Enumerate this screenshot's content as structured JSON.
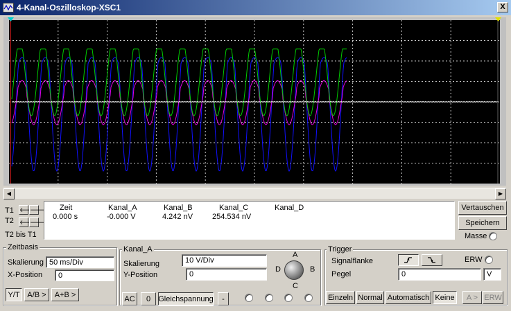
{
  "window": {
    "title": "4-Kanal-Oszilloskop-XSC1",
    "close_label": "X"
  },
  "cursors": {
    "t1_label": "T1",
    "t2_label": "T2",
    "t2_minus_t1_label": "T2 bis T1"
  },
  "readout": {
    "headers": [
      "Zeit",
      "Kanal_A",
      "Kanal_B",
      "Kanal_C",
      "Kanal_D"
    ],
    "row": [
      "0.000 s",
      "-0.000 V",
      "4.242 nV",
      "254.534 nV",
      ""
    ]
  },
  "side_buttons": {
    "reverse": "Vertauschen",
    "save": "Speichern",
    "ground": "Masse"
  },
  "timebase": {
    "title": "Zeitbasis",
    "scale_label": "Skalierung",
    "scale_value": "50 ms/Div",
    "xpos_label": "X-Position",
    "xpos_value": "0",
    "modes": [
      "Y/T",
      "A/B >",
      "A+B >"
    ],
    "active_mode": "Y/T"
  },
  "channel": {
    "title": "Kanal_A",
    "scale_label": "Skalierung",
    "scale_value": "10  V/Div",
    "ypos_label": "Y-Position",
    "ypos_value": "0",
    "coupling": [
      "AC",
      "0",
      "Gleichspannung",
      "-"
    ],
    "knob_labels": {
      "top": "A",
      "right": "B",
      "bottom": "C",
      "left": "D"
    }
  },
  "trigger": {
    "title": "Trigger",
    "edge_label": "Signalflanke",
    "ext_label": "ERW",
    "level_label": "Pegel",
    "level_value": "0",
    "level_unit": "V",
    "modes": [
      "Einzeln",
      "Normal",
      "Automatisch",
      "Keine"
    ],
    "active_mode": "Keine",
    "extra": [
      "A >",
      "ERW"
    ]
  },
  "colors": {
    "screen_bg": "#000000",
    "grid": "#c8c8c8",
    "trace_a": "#ffffff",
    "trace_b": "#00cc00",
    "trace_c": "#dd00dd",
    "trace_d": "#1010ff",
    "cursor_t1": "#ff2020"
  },
  "icons": {
    "app": "oscilloscope-icon"
  }
}
